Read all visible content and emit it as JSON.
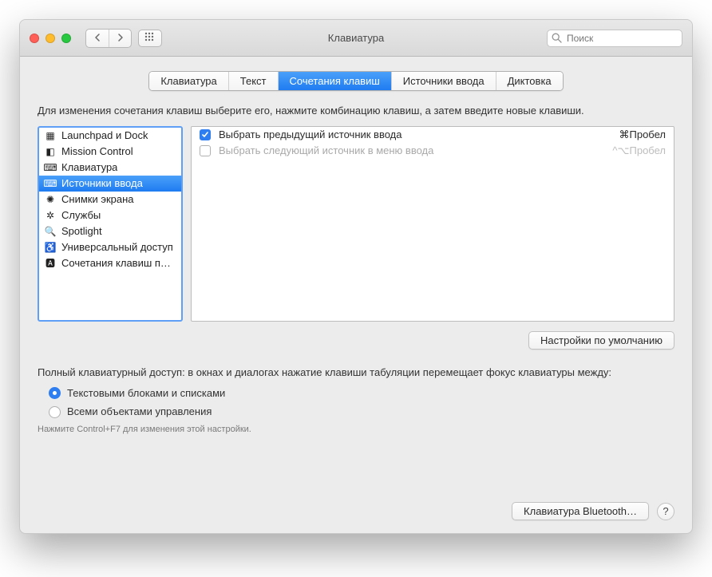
{
  "window": {
    "title": "Клавиатура",
    "search_placeholder": "Поиск"
  },
  "tabs": [
    {
      "label": "Клавиатура",
      "active": false
    },
    {
      "label": "Текст",
      "active": false
    },
    {
      "label": "Сочетания клавиш",
      "active": true
    },
    {
      "label": "Источники ввода",
      "active": false
    },
    {
      "label": "Диктовка",
      "active": false
    }
  ],
  "instruction": "Для изменения сочетания клавиш выберите его, нажмите комбинацию клавиш, а затем введите новые клавиши.",
  "sidebar": {
    "items": [
      {
        "icon": "launchpad-icon",
        "label": "Launchpad и Dock",
        "selected": false
      },
      {
        "icon": "mission-control-icon",
        "label": "Mission Control",
        "selected": false
      },
      {
        "icon": "keyboard-icon",
        "label": "Клавиатура",
        "selected": false
      },
      {
        "icon": "input-sources-icon",
        "label": "Источники ввода",
        "selected": true
      },
      {
        "icon": "screenshots-icon",
        "label": "Снимки экрана",
        "selected": false
      },
      {
        "icon": "services-icon",
        "label": "Службы",
        "selected": false
      },
      {
        "icon": "spotlight-icon",
        "label": "Spotlight",
        "selected": false
      },
      {
        "icon": "accessibility-icon",
        "label": "Универсальный доступ",
        "selected": false
      },
      {
        "icon": "app-shortcuts-icon",
        "label": "Сочетания клавиш пр…",
        "selected": false
      }
    ]
  },
  "shortcuts": {
    "rows": [
      {
        "checked": true,
        "label": "Выбрать предыдущий источник ввода",
        "shortcut": "⌘Пробел",
        "disabled": false
      },
      {
        "checked": false,
        "label": "Выбрать следующий источник в меню ввода",
        "shortcut": "^⌥Пробел",
        "disabled": true
      }
    ]
  },
  "restore_defaults_label": "Настройки по умолчанию",
  "fka": {
    "description": "Полный клавиатурный доступ: в окнах и диалогах нажатие клавиши табуляции перемещает фокус клавиатуры между:",
    "options": [
      {
        "label": "Текстовыми блоками и списками",
        "checked": true
      },
      {
        "label": "Всеми объектами управления",
        "checked": false
      }
    ],
    "hint": "Нажмите Control+F7 для изменения этой настройки."
  },
  "footer": {
    "bluetooth_button": "Клавиатура Bluetooth…",
    "help": "?"
  },
  "icons": {
    "launchpad-icon": "▦",
    "mission-control-icon": "◧",
    "keyboard-icon": "⌨",
    "input-sources-icon": "⌨",
    "screenshots-icon": "✺",
    "services-icon": "✲",
    "spotlight-icon": "🔍",
    "accessibility-icon": "♿",
    "app-shortcuts-icon": "🅰"
  }
}
